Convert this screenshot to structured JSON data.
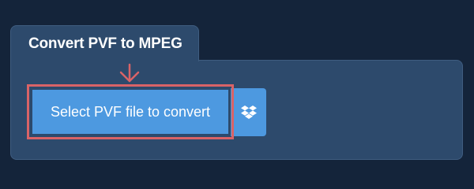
{
  "converter": {
    "tab_title": "Convert PVF to MPEG",
    "select_button_label": "Select PVF file to convert",
    "dropbox_icon": "dropbox-icon",
    "arrow_icon": "arrow-down-icon"
  },
  "colors": {
    "background": "#14243a",
    "panel": "#2d4a6c",
    "button": "#4d99e0",
    "highlight": "#d96367",
    "text": "#ffffff"
  }
}
